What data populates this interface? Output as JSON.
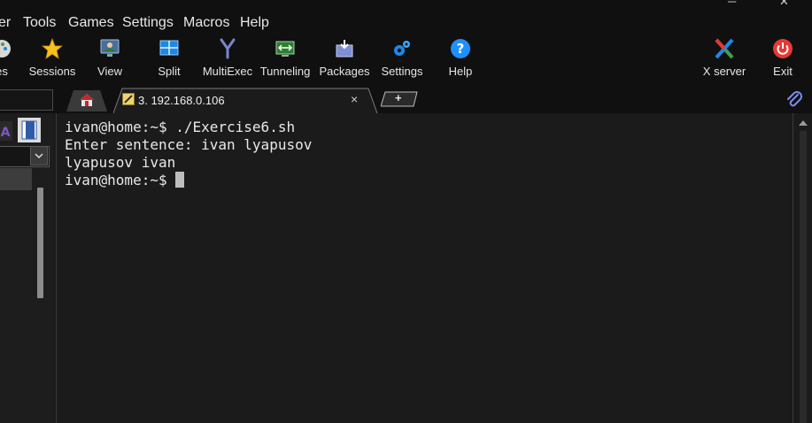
{
  "window": {
    "minimize_glyph": "─",
    "close_glyph": "✕"
  },
  "menu": {
    "items": [
      "er",
      "Tools",
      "Games",
      "Settings",
      "Macros",
      "Help"
    ]
  },
  "toolbar": {
    "items": [
      {
        "label": "es",
        "icon": "palette-icon"
      },
      {
        "label": "Sessions",
        "icon": "star-icon"
      },
      {
        "label": "View",
        "icon": "monitor-user-icon"
      },
      {
        "label": "Split",
        "icon": "split-icon"
      },
      {
        "label": "MultiExec",
        "icon": "fork-icon"
      },
      {
        "label": "Tunneling",
        "icon": "tunnel-icon"
      },
      {
        "label": "Packages",
        "icon": "package-icon"
      },
      {
        "label": "Settings",
        "icon": "gears-icon"
      },
      {
        "label": "Help",
        "icon": "help-icon"
      },
      {
        "label": "X server",
        "icon": "x-server-icon"
      },
      {
        "label": "Exit",
        "icon": "power-icon"
      }
    ]
  },
  "tabs": {
    "home_icon": "home-icon",
    "session_tab_label": "3. 192.168.0.106",
    "close_glyph": "×",
    "new_tab_glyph": "+"
  },
  "terminal": {
    "lines": [
      "ivan@home:~$ ./Exercise6.sh",
      "Enter sentence: ivan lyapusov",
      "lyapusov ivan",
      "ivan@home:~$ "
    ]
  },
  "colors": {
    "background": "#1b1b1b",
    "menubar": "#101010",
    "help_blue": "#1e90ff",
    "exit_red": "#e53935",
    "star_gold": "#f6c21a"
  }
}
